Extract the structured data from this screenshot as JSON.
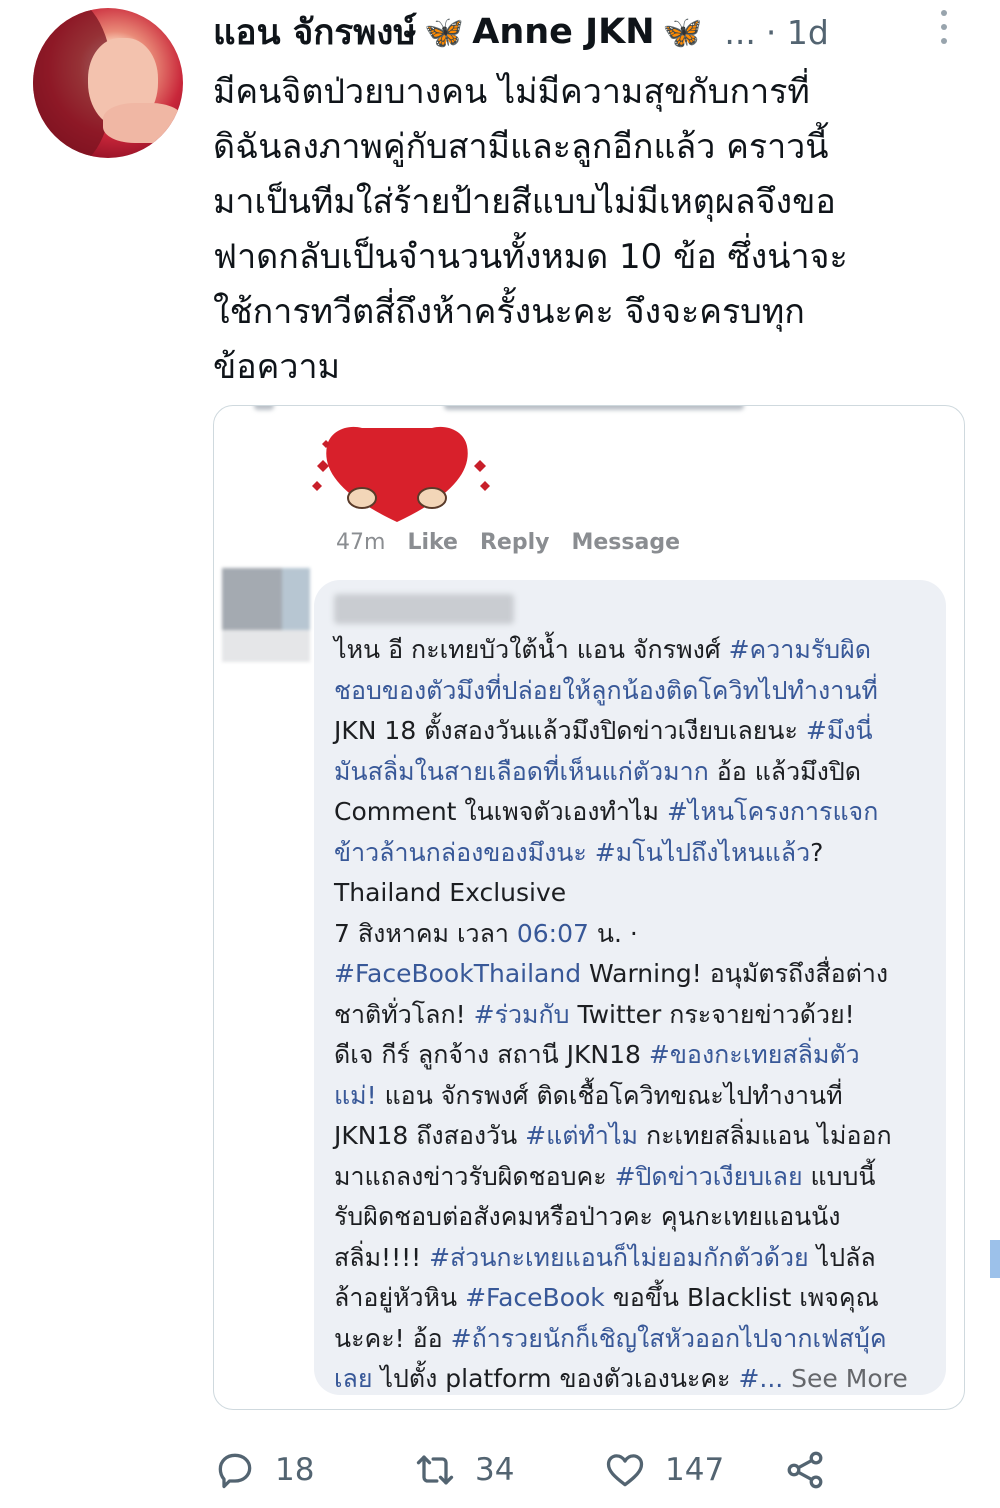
{
  "tweet": {
    "display_name_th": "แอน จักรพงษ์",
    "display_name_en": "Anne JKN",
    "name_emoji": "🦋",
    "ellipsis": "...",
    "time": "· 1d",
    "text_lines": [
      "มีคนจิตป่วยบางคน ไม่มีความสุขกับการที่",
      "ดิฉันลงภาพคู่กับสามีและลูกอีกแล้ว คราวนี้",
      "มาเป็นทีมใส่ร้ายป้ายสีแบบไม่มีเหตุผลจึงขอ",
      "ฟาดกลับเป็นจำนวนทั้งหมด 10 ข้อ ซึ่งน่าจะ",
      "ใช้การทวีตสี่ถึงห้าครั้งนะคะ จึงจะครบทุก",
      "ข้อความ"
    ]
  },
  "screenshot": {
    "comment_meta": {
      "time": "47m",
      "like": "Like",
      "reply": "Reply",
      "message": "Message"
    },
    "line1": {
      "a": "ไหน อี กะเทยบัวใต้น้ำ แอน จักรพงศ์ ",
      "b": "#ความรับผิด"
    },
    "line2": "ชอบของตัวมึงที่ปล่อยให้ลูกน้องติดโควิทไปทำงานที่",
    "line3": {
      "a": "JKN 18 ตั้งสองวันแล้วมึงปิดข่าวเงียบเลยนะ ",
      "b": "#มึงนี่"
    },
    "line4": {
      "a": "มันสลิ่มในสายเลือดที่เห็นแก่ตัวมาก",
      "b": " อ้อ แล้วมึงปิด"
    },
    "line5": {
      "a": "Comment ในเพจตัวเองทำไม ",
      "b": "#ไหนโครงการแจก"
    },
    "line6": {
      "a": "ข้าวล้านกล่องของมึงนะ ",
      "b": "#มโนไปถึงไหนแล้ว",
      "c": "?"
    },
    "line7": "Thailand Exclusive",
    "line8": {
      "a": "7 สิงหาคม เวลา ",
      "b": "06:07",
      "c": " น. ·"
    },
    "line9": {
      "a": "#FaceBookThailand",
      "b": " Warning! อนุมัตรถึงสื่อต่าง"
    },
    "line10": {
      "a": "ชาติทั่วโลก! ",
      "b": "#ร่วมกับ",
      "c": " Twitter กระจายข่าวด้วย!"
    },
    "line11": {
      "a": "ดีเจ กีร์ ลูกจ้าง สถานี JKN18 ",
      "b": "#ของกะเทยสลิ่มตัว"
    },
    "line12": {
      "a": "แม่!",
      "b": " แอน จักรพงศ์ ติดเชื้อโควิทขณะไปทำงานที่"
    },
    "line13": {
      "a": "JKN18 ถึงสองวัน ",
      "b": "#แต่ทำไม",
      "c": " กะเทยสลิ่มแอน ไม่ออก"
    },
    "line14": {
      "a": "มาแถลงข่าวรับผิดชอบคะ ",
      "b": "#ปิดข่าวเงียบเลย",
      "c": " แบบนี้"
    },
    "line15": "รับผิดชอบต่อสังคมหรือป่าวคะ คุนกะเทยแอนนัง",
    "line16": {
      "a": "สลิ่ม!!!! ",
      "b": "#ส่วนกะเทยแอนก็ไม่ยอมกักตัวด้วย",
      "c": " ไปลัล"
    },
    "line17": {
      "a": "ล้าอยู่หัวหิน ",
      "b": "#FaceBook",
      "c": " ขอขึ้น Blacklist เพจคุณ"
    },
    "line18": {
      "a": "นะคะ! อ้อ ",
      "b": "#ถ้ารวยนักก็เชิญใสหัวออกไปจากเฟสบุ้ค"
    },
    "line19": {
      "a": "เลย",
      "b": " ไปตั้ง platform ของตัวเองนะคะ ",
      "c": "#...",
      "d": " See More"
    }
  },
  "actions": {
    "reply_count": "18",
    "retweet_count": "34",
    "like_count": "147",
    "icons": [
      "reply-icon",
      "retweet-icon",
      "like-icon",
      "share-icon"
    ]
  },
  "colors": {
    "text": "#0f1419",
    "secondary": "#536471",
    "hashtag": "#385898",
    "bubble": "#edf0f5"
  }
}
